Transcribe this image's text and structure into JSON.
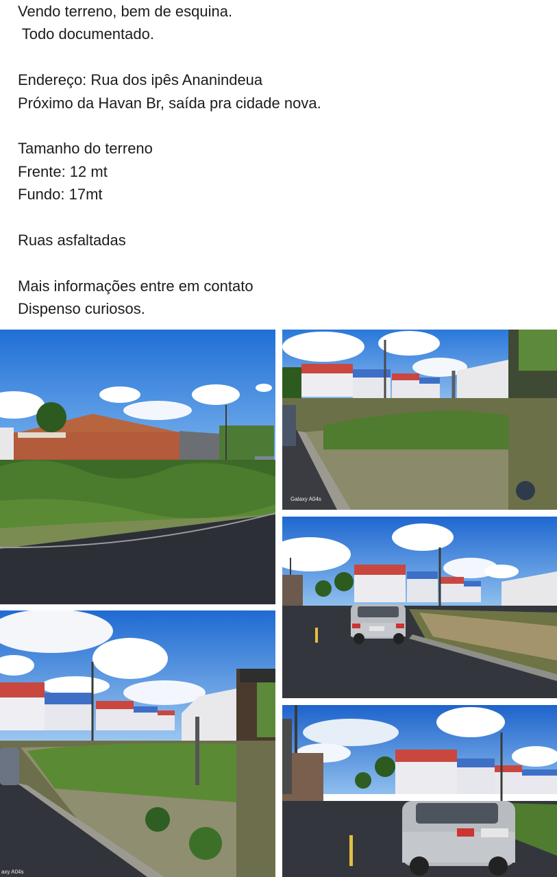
{
  "post": {
    "lines": [
      "Vendo terreno, bem de esquina.",
      " Todo documentado.",
      "",
      "Endereço: Rua dos ipês Ananindeua",
      "Próximo da Havan Br, saída pra cidade nova.",
      "",
      "Tamanho do terreno",
      "Frente: 12 mt",
      "Fundo: 17mt",
      "",
      "Ruas asfaltadas",
      "",
      "Mais informações entre em contato",
      "Dispenso curiosos."
    ]
  },
  "photos": {
    "photo2_watermark": "Galaxy A04s",
    "photo4_watermark": "axy A04s"
  },
  "colors": {
    "sky": "#2f7fe0",
    "grass": "#3f6b2a",
    "asphalt": "#2d2f36",
    "house_red": "#c9473f",
    "house_blue": "#3d6fc7",
    "brick": "#b15a3c"
  }
}
